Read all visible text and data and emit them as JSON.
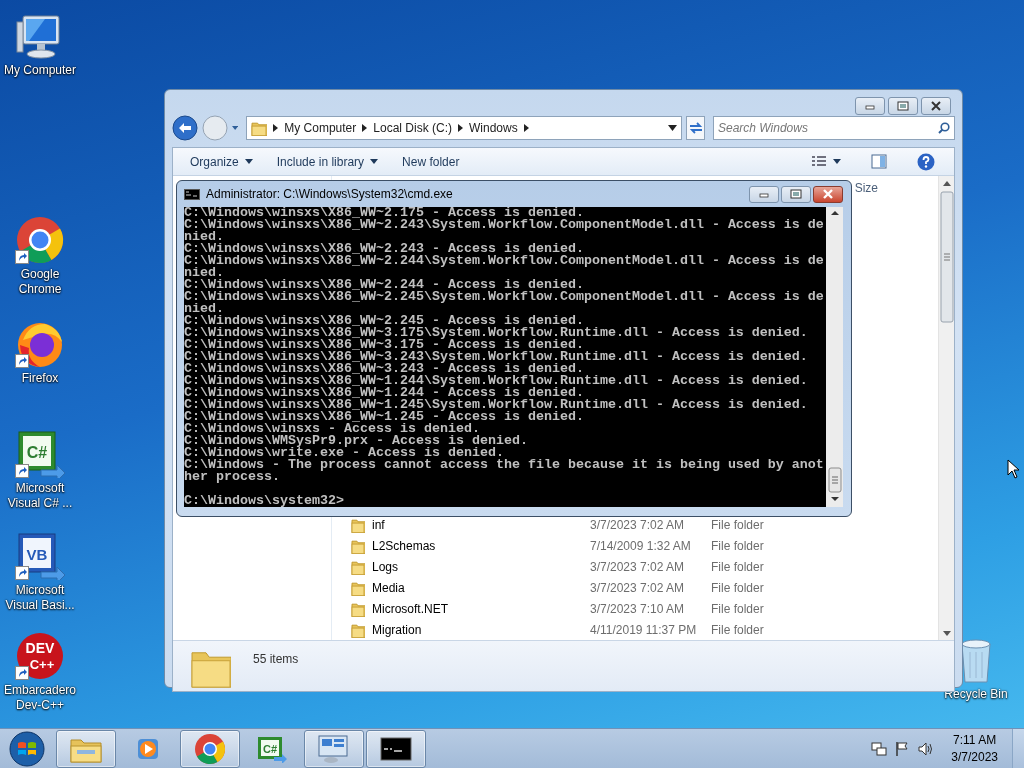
{
  "desktop_icons": [
    {
      "label": "My Computer",
      "kind": "computer",
      "shortcut": false
    },
    {
      "label": "Google Chrome",
      "kind": "chrome",
      "shortcut": true
    },
    {
      "label": "Firefox",
      "kind": "firefox",
      "shortcut": true
    },
    {
      "label": "Microsoft Visual C# ...",
      "kind": "csharp",
      "icon_text": "C#",
      "shortcut": true
    },
    {
      "label": "Microsoft Visual Basi...",
      "kind": "vb",
      "icon_text": "VB",
      "shortcut": true
    },
    {
      "label": "Embarcadero Dev-C++",
      "kind": "devcpp",
      "icon_text": "DEV",
      "icon_text_2": "C++",
      "shortcut": true
    },
    {
      "label": "Recycle Bin",
      "kind": "recycle",
      "shortcut": false
    }
  ],
  "explorer": {
    "address": [
      "My Computer",
      "Local Disk (C:)",
      "Windows"
    ],
    "search": {
      "placeholder": "Search Windows"
    },
    "toolbar": [
      {
        "label": "Organize",
        "dropdown": true
      },
      {
        "label": "Include in library",
        "dropdown": true
      },
      {
        "label": "New folder",
        "dropdown": false
      }
    ],
    "column_header": "Size",
    "files": [
      {
        "name": "inf",
        "date": "3/7/2023 7:02 AM",
        "type": "File folder"
      },
      {
        "name": "L2Schemas",
        "date": "7/14/2009 1:32 AM",
        "type": "File folder"
      },
      {
        "name": "Logs",
        "date": "3/7/2023 7:02 AM",
        "type": "File folder"
      },
      {
        "name": "Media",
        "date": "3/7/2023 7:02 AM",
        "type": "File folder"
      },
      {
        "name": "Microsoft.NET",
        "date": "3/7/2023 7:10 AM",
        "type": "File folder"
      },
      {
        "name": "Migration",
        "date": "4/11/2019 11:37 PM",
        "type": "File folder"
      }
    ],
    "status": "55 items"
  },
  "console": {
    "title": "Administrator: C:\\Windows\\System32\\cmd.exe",
    "lines": [
      "C:\\Windows\\winsxs\\X86_WW~2.175 - Access is denied.",
      "C:\\Windows\\winsxs\\X86_WW~2.243\\System.Workflow.ComponentModel.dll - Access is de",
      "nied.",
      "C:\\Windows\\winsxs\\X86_WW~2.243 - Access is denied.",
      "C:\\Windows\\winsxs\\X86_WW~2.244\\System.Workflow.ComponentModel.dll - Access is de",
      "nied.",
      "C:\\Windows\\winsxs\\X86_WW~2.244 - Access is denied.",
      "C:\\Windows\\winsxs\\X86_WW~2.245\\System.Workflow.ComponentModel.dll - Access is de",
      "nied.",
      "C:\\Windows\\winsxs\\X86_WW~2.245 - Access is denied.",
      "C:\\Windows\\winsxs\\X86_WW~3.175\\System.Workflow.Runtime.dll - Access is denied.",
      "C:\\Windows\\winsxs\\X86_WW~3.175 - Access is denied.",
      "C:\\Windows\\winsxs\\X86_WW~3.243\\System.Workflow.Runtime.dll - Access is denied.",
      "C:\\Windows\\winsxs\\X86_WW~3.243 - Access is denied.",
      "C:\\Windows\\winsxs\\X86_WW~1.244\\System.Workflow.Runtime.dll - Access is denied.",
      "C:\\Windows\\winsxs\\X86_WW~1.244 - Access is denied.",
      "C:\\Windows\\winsxs\\X86_WW~1.245\\System.Workflow.Runtime.dll - Access is denied.",
      "C:\\Windows\\winsxs\\X86_WW~1.245 - Access is denied.",
      "C:\\Windows\\winsxs - Access is denied.",
      "C:\\Windows\\WMSysPr9.prx - Access is denied.",
      "C:\\Windows\\write.exe - Access is denied.",
      "C:\\Windows - The process cannot access the file because it is being used by anot",
      "her process."
    ],
    "prompt": "C:\\Windows\\system32>"
  },
  "taskbar": {
    "apps": [
      {
        "kind": "explorer",
        "open": true
      },
      {
        "kind": "media",
        "open": false
      },
      {
        "kind": "chrome",
        "open": true
      },
      {
        "kind": "csharp",
        "icon_text": "C#",
        "open": false
      },
      {
        "kind": "remote",
        "open": true
      },
      {
        "kind": "cmd",
        "open": true
      }
    ],
    "clock": {
      "time": "7:11 AM",
      "date": "3/7/2023"
    }
  }
}
